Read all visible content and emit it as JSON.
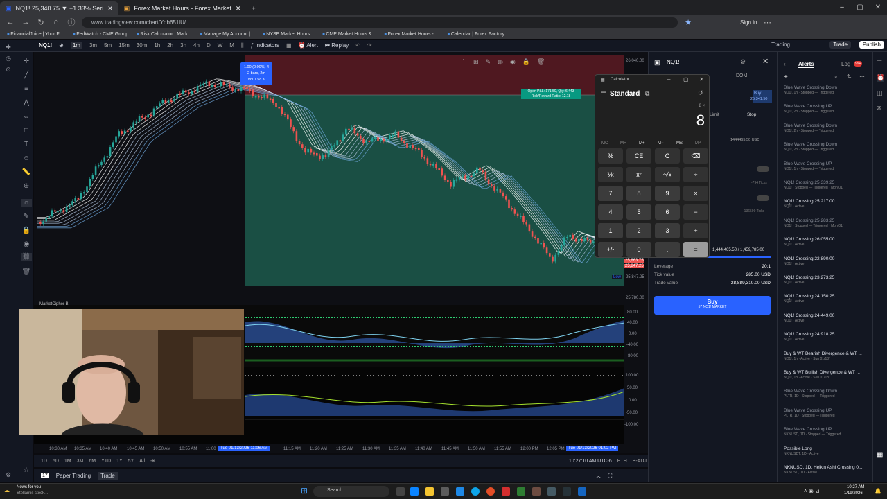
{
  "browser": {
    "tabs": [
      {
        "label": "NQ1! 25,340.75 ▼ −1.33% Seri"
      },
      {
        "label": "Forex Market Hours - Forex Market"
      }
    ],
    "new_tab": "+",
    "url": "www.tradingview.com/chart/Ydb651lU/",
    "bookmarks": [
      "FinancialJuice | Your Fi...",
      "FedWatch - CME Group",
      "Risk Calculator | Mark...",
      "Manage My Account |...",
      "NYSE Market Hours...",
      "CME Market Hours &...",
      "Forex Market Hours - ...",
      "Calendar | Forex Factory"
    ],
    "signin": "Sign in"
  },
  "toolbar": {
    "symbol": "NQ1!",
    "timeframes": [
      "1m",
      "3m",
      "5m",
      "15m",
      "30m",
      "1h",
      "2h",
      "3h",
      "4h",
      "D",
      "W",
      "M"
    ],
    "selected_tf": "1m",
    "indicators": "Indicators",
    "alert": "Alert",
    "replay": "Replay",
    "trading": "Trading",
    "trade": "Trade",
    "publish": "Publish"
  },
  "chart": {
    "measure_box": {
      "line1": "1.00 (0.00%) 4",
      "line2": "2 bars, 2m",
      "line3": "Vol 1.58 K"
    },
    "position_label": {
      "line1": "Open P&L: 171.50, Qty: 6.443",
      "line2": "Risk/Reward Ratio: 12.18"
    },
    "indicator_name": "MarketCipher B",
    "low_label": "Low",
    "colors": {
      "up": "#26a69a",
      "down": "#ef5350",
      "profit_zone": "#1c5a4c",
      "loss_zone": "#5a1a22"
    }
  },
  "price_axis": {
    "labels": [
      "26,040.00",
      "25,863.75",
      "25,847.25",
      "25,847.25",
      "25,780.00",
      "80.00",
      "40.00",
      "0.00",
      "-40.00",
      "-80.00",
      "100.00",
      "50.00",
      "0.00",
      "-50.00",
      "-100.00"
    ],
    "tags": [
      {
        "text": "25,863.75",
        "color": "#ef5350"
      },
      {
        "text": "25,847.25",
        "color": "#ef5350"
      }
    ]
  },
  "time_axis": {
    "labels": [
      "10:30 AM",
      "10:35 AM",
      "10:40 AM",
      "10:45 AM",
      "10:50 AM",
      "10:55 AM",
      "11:00",
      "11:15 AM",
      "11:20 AM",
      "11:25 AM",
      "11:30 AM",
      "11:35 AM",
      "11:40 AM",
      "11:45 AM",
      "11:50 AM",
      "11:55 AM",
      "12:00 PM",
      "12:05 PM"
    ],
    "highlight1": "Tue 01/13/2026  11:06 AM",
    "highlight2": "Tue 01/13/2026  01:02 PM"
  },
  "range_bar": {
    "items": [
      "1D",
      "5D",
      "1M",
      "3M",
      "6M",
      "YTD",
      "1Y",
      "5Y",
      "All"
    ],
    "clock": "10:27:10 AM UTC-6",
    "session": "ETH",
    "adj": "B-ADJ"
  },
  "bottom_panel": {
    "paper": "Paper Trading",
    "trade": "Trade"
  },
  "trade_panel": {
    "symbol": "NQ1!",
    "dom": "DOM",
    "limit": "Limit",
    "stop": "Stop",
    "buy_price": "25,341.50",
    "buy_label": "Buy",
    "value1": "1444465.50 USD",
    "ticks1": "-794 Ticks",
    "ticks2": "-136599 Ticks",
    "range_value": "1,444,465.50 / 1,459,785.00",
    "rows": [
      {
        "k": "Leverage",
        "v": "20:1"
      },
      {
        "k": "Tick value",
        "v": "285.00 USD"
      },
      {
        "k": "Trade value",
        "v": "28,889,310.00 USD"
      }
    ],
    "buy_button": "Buy",
    "buy_sub": "57 NQ1! MARKET"
  },
  "calculator": {
    "title": "Calculator",
    "mode": "Standard",
    "expression": "8 ×",
    "display": "8",
    "memory": [
      "MC",
      "MR",
      "M+",
      "M−",
      "MS",
      "M˅"
    ],
    "keys": [
      [
        "%",
        "CE",
        "C",
        "⌫"
      ],
      [
        "⅟x",
        "x²",
        "²√x",
        "÷"
      ],
      [
        "7",
        "8",
        "9",
        "×"
      ],
      [
        "4",
        "5",
        "6",
        "−"
      ],
      [
        "1",
        "2",
        "3",
        "+"
      ],
      [
        "+/-",
        "0",
        ".",
        "="
      ]
    ]
  },
  "alerts": {
    "title": "Alerts",
    "log": "Log",
    "log_badge": "99+",
    "items": [
      {
        "t": "Blue Wave Crossing Down",
        "s": "NQ1!, 1h · Stopped — Triggered",
        "dim": true
      },
      {
        "t": "Blue Wave Crossing UP",
        "s": "NQ1!, 2h · Stopped — Triggered",
        "dim": true
      },
      {
        "t": "Blue Wave Crossing Down",
        "s": "NQ1!, 2h · Stopped — Triggered",
        "dim": true
      },
      {
        "t": "Blue Wave Crossing Down",
        "s": "NQ1!, 2h · Stopped — Triggered",
        "dim": true
      },
      {
        "t": "Blue Wave Crossing UP",
        "s": "NQ1!, 1h · Stopped — Triggered",
        "dim": true
      },
      {
        "t": "NQ1! Crossing 25,339.25",
        "s": "NQ1! · Stopped — Triggered · Mon 01/",
        "dim": true
      },
      {
        "t": "NQ1! Crossing 25,217.00",
        "s": "NQ1! · Active",
        "dim": false
      },
      {
        "t": "NQ1! Crossing 25,283.25",
        "s": "NQ1! · Stopped — Triggered · Mon 01/",
        "dim": true
      },
      {
        "t": "NQ1! Crossing 26,055.00",
        "s": "NQ1! · Active",
        "dim": false
      },
      {
        "t": "NQ1! Crossing 22,890.00",
        "s": "NQ1! · Active",
        "dim": false
      },
      {
        "t": "NQ1! Crossing 23,273.25",
        "s": "NQ1! · Active",
        "dim": false
      },
      {
        "t": "NQ1! Crossing 24,150.25",
        "s": "NQ1! · Active",
        "dim": false
      },
      {
        "t": "NQ1! Crossing 24,449.00",
        "s": "NQ1! · Active",
        "dim": false
      },
      {
        "t": "NQ1! Crossing 24,918.25",
        "s": "NQ1! · Active",
        "dim": false
      },
      {
        "t": "Buy & WT Bearish Divergence & WT ...",
        "s": "NQ1!, 1h · Active · Sun 01/18/",
        "dim": false
      },
      {
        "t": "Buy & WT Bullish Divergence & WT ...",
        "s": "NQ1!, 1h · Active · Sun 01/18/",
        "dim": false
      },
      {
        "t": "Blue Wave Crossing Down",
        "s": "PLTR, 1D · Stopped — Triggered",
        "dim": true
      },
      {
        "t": "Blue Wave Crossing UP",
        "s": "PLTR, 1D · Stopped — Triggered",
        "dim": true
      },
      {
        "t": "Blue Wave Crossing UP",
        "s": "NKNUSD, 1D · Stopped — Triggered",
        "dim": true
      },
      {
        "t": "Possible Long",
        "s": "NKNUSDT, 1D · Active",
        "dim": false
      },
      {
        "t": "NKNUSD, 1D, Heikin Ashi Crossing 0....",
        "s": "NKNUSD, 1D · Active",
        "dim": false
      }
    ]
  },
  "taskbar": {
    "news_title": "News for you",
    "news_sub": "Stellantis stock...",
    "search": "Search",
    "time": "10:27 AM",
    "date": "1/19/2026"
  }
}
